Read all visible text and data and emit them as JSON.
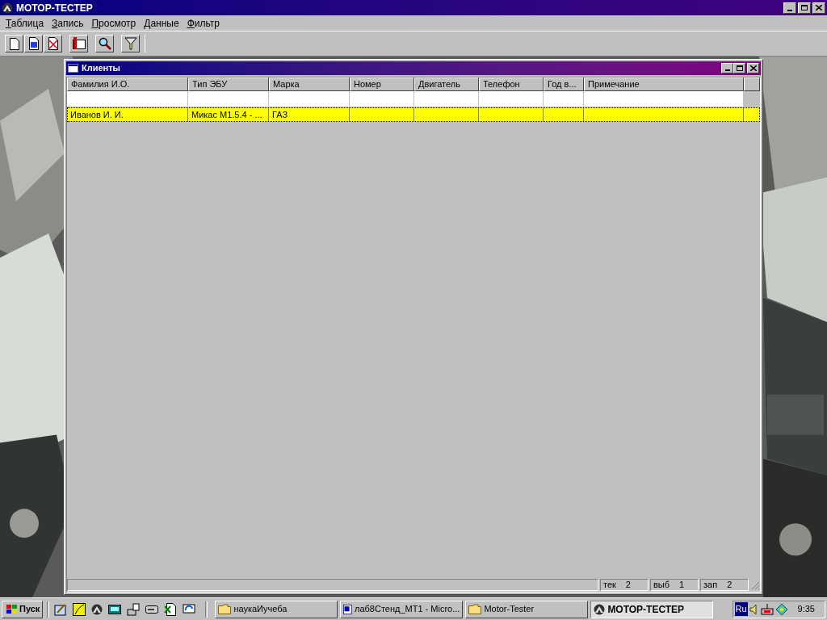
{
  "app": {
    "title": "МОТОР-ТЕСТЕР"
  },
  "menu": [
    {
      "label": "Таблица"
    },
    {
      "label": "Запись"
    },
    {
      "label": "Просмотр"
    },
    {
      "label": "Данные"
    },
    {
      "label": "Фильтр"
    }
  ],
  "toolbar": [
    {
      "kind": "new"
    },
    {
      "kind": "edit"
    },
    {
      "kind": "delete"
    },
    {
      "kind": "book"
    },
    {
      "kind": "search"
    },
    {
      "kind": "filter"
    }
  ],
  "child_window": {
    "title": "Клиенты",
    "columns": [
      "Фамилия И.О.",
      "Тип ЭБУ",
      "Марка",
      "Номер",
      "Двигатель",
      "Телефон",
      "Год в...",
      "Примечание"
    ],
    "rows": [
      {
        "cells": [
          "Иванов И. И.",
          "Микас М1.5.4 - ...",
          "ГАЗ"
        ],
        "selected": true
      }
    ],
    "status": [
      {
        "label": "тек",
        "value": "2"
      },
      {
        "label": "выб",
        "value": "1"
      },
      {
        "label": "зап",
        "value": "2"
      }
    ]
  },
  "taskbar": {
    "start": "Пуск",
    "quick_launch": [
      {
        "kind": "pen"
      },
      {
        "kind": "feather"
      },
      {
        "kind": "logo"
      },
      {
        "kind": "keyboard"
      },
      {
        "kind": "scanner"
      },
      {
        "kind": "drive"
      },
      {
        "kind": "sheet"
      },
      {
        "kind": "sync"
      }
    ],
    "tasks": [
      {
        "label": "наукаИучеба",
        "kind": "folder",
        "selected": false
      },
      {
        "label": "лаб8Стенд_MT1 - Micro...",
        "kind": "word",
        "selected": false
      },
      {
        "label": "Motor-Tester",
        "kind": "folder",
        "selected": false
      },
      {
        "label": "МОТОР-ТЕСТЕР",
        "kind": "logo",
        "selected": true
      }
    ],
    "tray": {
      "language": "Ru",
      "clock": "9:35"
    }
  }
}
